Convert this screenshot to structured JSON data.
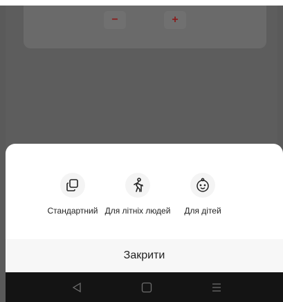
{
  "background": {
    "stepper": {
      "minus_label": "−",
      "plus_label": "+"
    }
  },
  "sheet": {
    "options": [
      {
        "label": "Стандартний",
        "icon": "copy-icon"
      },
      {
        "label": "Для літніх людей",
        "icon": "elderly-person-icon"
      },
      {
        "label": "Для дітей",
        "icon": "baby-face-icon"
      }
    ],
    "close_label": "Закрити"
  },
  "navbar": {
    "buttons": [
      "back-icon",
      "home-icon",
      "menu-icon"
    ]
  },
  "colors": {
    "overlay": "#5a5a5a",
    "sheet": "#ffffff",
    "close_row": "#f7f7f7",
    "navbar": "#141414",
    "stepper_accent": "#8a1c1c"
  }
}
